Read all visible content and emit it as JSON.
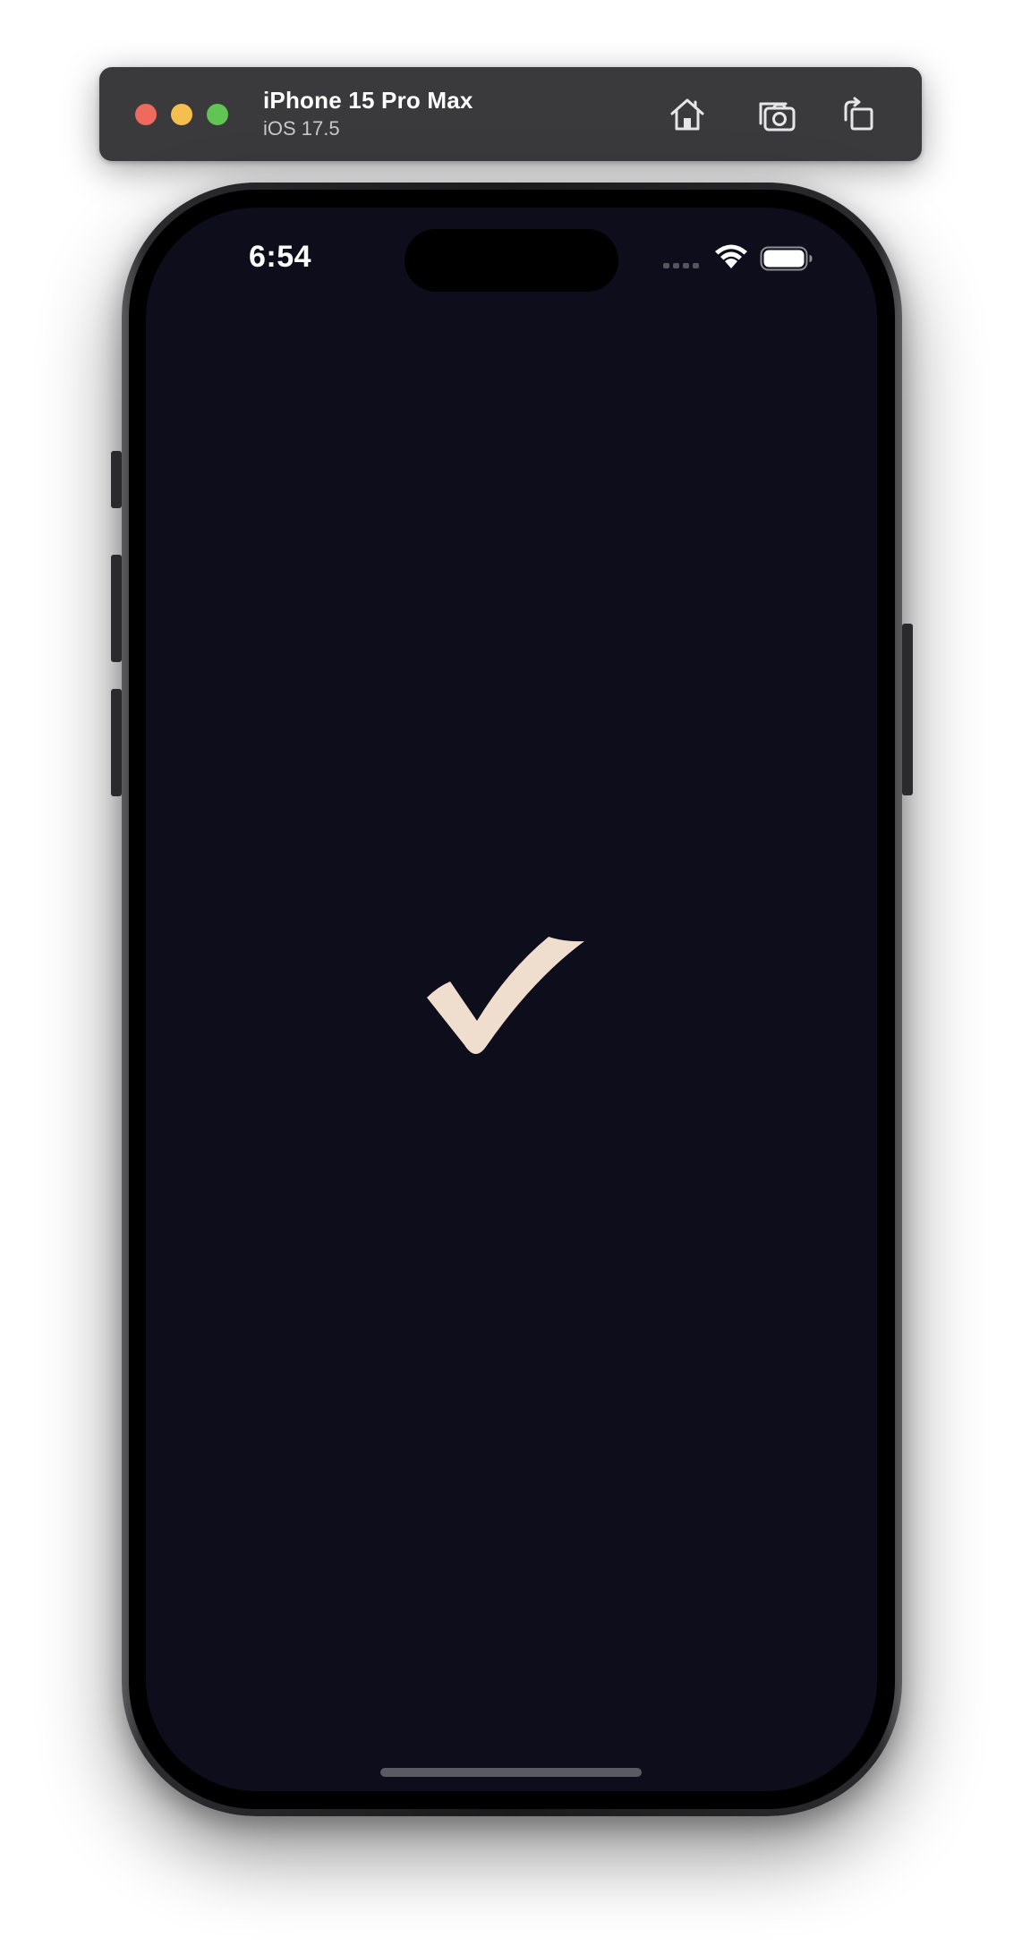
{
  "simulator": {
    "device_name": "iPhone 15 Pro Max",
    "os_version": "iOS 17.5",
    "toolbar_icons": [
      "home-icon",
      "screenshot-icon",
      "rotate-icon"
    ],
    "window_controls": [
      "close",
      "minimize",
      "zoom"
    ]
  },
  "status_bar": {
    "time": "6:54",
    "icons": [
      "cellular-signal-icon",
      "wifi-icon",
      "battery-icon"
    ]
  },
  "app": {
    "background_color": "#0d0d1b",
    "center_icon": "checkmark-icon",
    "accent_color": "#efdecd"
  }
}
